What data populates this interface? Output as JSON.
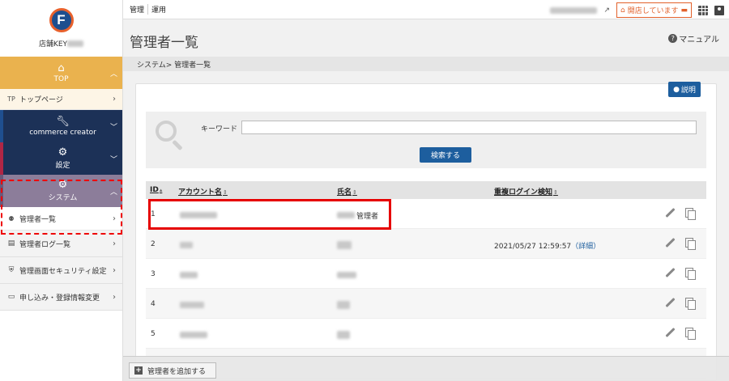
{
  "logo": {
    "letter": "F"
  },
  "sidebar": {
    "store_key_label": "店舗KEY",
    "top": {
      "icon": "home-icon",
      "label": "TOP"
    },
    "top_items": [
      {
        "icon_text": "TP",
        "label": "トップページ"
      }
    ],
    "commerce": {
      "icon": "wrench-icon",
      "label": "commerce creator"
    },
    "settings": {
      "icon": "gear-square-icon",
      "label": "設定"
    },
    "system": {
      "icon": "gear-icon",
      "label": "システム"
    },
    "system_items": [
      {
        "label": "管理者一覧"
      }
    ],
    "menu": [
      {
        "icon": "log-icon",
        "label": "管理者ログ一覧"
      },
      {
        "icon": "shield-icon",
        "label": "管理画面セキュリティ設定"
      },
      {
        "icon": "card-icon",
        "label": "申し込み・登録情報変更"
      }
    ]
  },
  "topbar": {
    "nav": [
      "管理",
      "運用"
    ],
    "open_status": "開店しています"
  },
  "page": {
    "title": "管理者一覧",
    "manual": "マニュアル",
    "breadcrumb": "システム> 管理者一覧",
    "explain": "説明"
  },
  "search": {
    "keyword_label": "キーワード",
    "keyword_value": "",
    "button": "検索する"
  },
  "table": {
    "headers": [
      "ID",
      "アカウント名",
      "氏名",
      "重複ログイン検知"
    ],
    "rows": [
      {
        "id": "1",
        "name_suffix": "管理者",
        "login": "",
        "detail": ""
      },
      {
        "id": "2",
        "name_suffix": "",
        "login": "2021/05/27 12:59:57",
        "detail": "（詳細）"
      },
      {
        "id": "3",
        "name_suffix": "",
        "login": "",
        "detail": ""
      },
      {
        "id": "4",
        "name_suffix": "",
        "login": "",
        "detail": ""
      },
      {
        "id": "5",
        "name_suffix": "",
        "login": "",
        "detail": ""
      }
    ]
  },
  "footer": {
    "add_button": "管理者を追加する"
  },
  "colors": {
    "accent": "#1d5e9e",
    "top": "#eab24e",
    "nav_dark": "#1c3157",
    "system": "#8c7d9a",
    "open_badge": "#e2612b",
    "highlight": "#e60000"
  }
}
